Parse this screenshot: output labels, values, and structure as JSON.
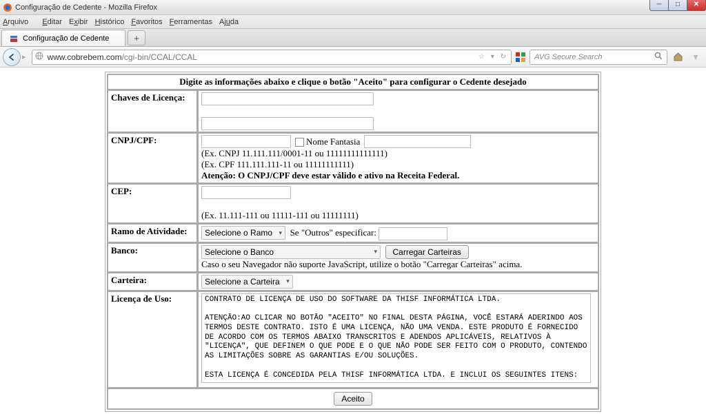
{
  "window": {
    "title": "Configuração de Cedente - Mozilla Firefox"
  },
  "menu": {
    "items": [
      "Arquivo",
      "Editar",
      "Exibir",
      "Histórico",
      "Favoritos",
      "Ferramentas",
      "Ajuda"
    ]
  },
  "tab": {
    "label": "Configuração de Cedente"
  },
  "url": {
    "host": "www.cobrebem.com",
    "path": "/cgi-bin/CCAL/CCAL"
  },
  "search": {
    "placeholder": "AVG Secure Search"
  },
  "form": {
    "header": "Digite as informações abaixo e clique o botão \"Aceito\" para configurar o Cedente desejado",
    "chaves_label": "Chaves de Licença:",
    "cnpj_label": "CNPJ/CPF:",
    "nome_fantasia_label": "Nome Fantasia",
    "cnpj_hint1": "(Ex. CNPJ 11.111.111/0001-11 ou 11111111111111)",
    "cnpj_hint2": "(Ex. CPF 111.111.111-11 ou 11111111111)",
    "cnpj_warning": "Atenção: O CNPJ/CPF deve estar válido e ativo na Receita Federal.",
    "cep_label": "CEP:",
    "cep_hint": "(Ex. 11.111-111 ou 11111-111 ou 11111111)",
    "ramo_label": "Ramo de Atividade:",
    "ramo_select": "Selecione o Ramo",
    "ramo_outros_label": "Se \"Outros\" especificar:",
    "banco_label": "Banco:",
    "banco_select": "Selecione o Banco",
    "carregar_carteiras": "Carregar Carteiras",
    "banco_hint": "Caso o seu Navegador não suporte JavaScript, utilize o botão \"Carregar Carteiras\" acima.",
    "carteira_label": "Carteira:",
    "carteira_select": "Selecione a Carteira",
    "licenca_label": "Licença de Uso:",
    "license_text": "CONTRATO DE LICENÇA DE USO DO SOFTWARE DA THISF INFORMÁTICA LTDA.\n\nATENÇÃO:AO CLICAR NO BOTÃO \"ACEITO\" NO FINAL DESTA PÁGINA, VOCÊ ESTARÁ ADERINDO AOS TERMOS DESTE CONTRATO. ISTO É UMA LICENÇA, NÃO UMA VENDA. ESTE PRODUTO É FORNECIDO DE ACORDO COM OS TERMOS ABAIXO TRANSCRITOS E ADENDOS APLICÁVEIS, RELATIVOS À \"LICENÇA\", QUE DEFINEM O QUE PODE E O QUE NÃO PODE SER FEITO COM O PRODUTO, CONTENDO AS LIMITAÇÕES SOBRE AS GARANTIAS E/OU SOLUÇÕES.\n\nESTA LICENÇA É CONCEDIDA PELA THISF INFORMÁTICA LTDA. E INCLUI OS SEGUINTES ITENS:",
    "aceito": "Aceito"
  }
}
